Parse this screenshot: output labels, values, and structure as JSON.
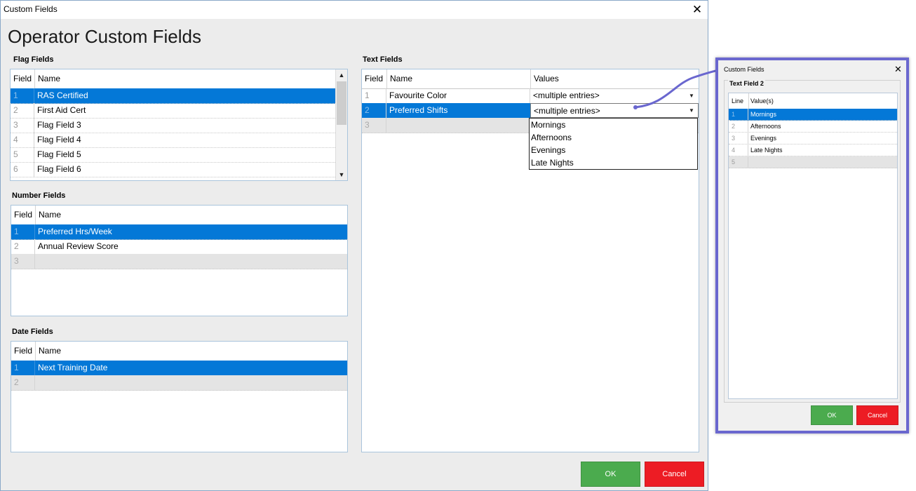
{
  "window": {
    "title": "Custom Fields",
    "heading": "Operator Custom Fields"
  },
  "flag_fields": {
    "label": "Flag Fields",
    "columns": [
      "Field",
      "Name"
    ],
    "rows": [
      {
        "num": "1",
        "name": "RAS Certified"
      },
      {
        "num": "2",
        "name": "First Aid Cert"
      },
      {
        "num": "3",
        "name": "Flag Field 3"
      },
      {
        "num": "4",
        "name": "Flag Field 4"
      },
      {
        "num": "5",
        "name": "Flag Field 5"
      },
      {
        "num": "6",
        "name": "Flag Field 6"
      }
    ]
  },
  "number_fields": {
    "label": "Number Fields",
    "columns": [
      "Field",
      "Name"
    ],
    "rows": [
      {
        "num": "1",
        "name": "Preferred Hrs/Week"
      },
      {
        "num": "2",
        "name": "Annual Review Score"
      },
      {
        "num": "3",
        "name": ""
      }
    ]
  },
  "date_fields": {
    "label": "Date Fields",
    "columns": [
      "Field",
      "Name"
    ],
    "rows": [
      {
        "num": "1",
        "name": "Next Training Date"
      },
      {
        "num": "2",
        "name": ""
      }
    ]
  },
  "text_fields": {
    "label": "Text Fields",
    "columns": [
      "Field",
      "Name",
      "Values"
    ],
    "rows": [
      {
        "num": "1",
        "name": "Favourite Color",
        "value": "<multiple entries>"
      },
      {
        "num": "2",
        "name": "Preferred Shifts",
        "value": "<multiple entries>"
      },
      {
        "num": "3",
        "name": "",
        "value": ""
      }
    ],
    "dropdown_options": [
      "Mornings",
      "Afternoons",
      "Evenings",
      "Late Nights"
    ]
  },
  "buttons": {
    "ok": "OK",
    "cancel": "Cancel"
  },
  "popup": {
    "title": "Custom Fields",
    "group_label": "Text Field 2",
    "columns": [
      "Line",
      "Value(s)"
    ],
    "rows": [
      {
        "num": "1",
        "value": "Mornings"
      },
      {
        "num": "2",
        "value": "Afternoons"
      },
      {
        "num": "3",
        "value": "Evenings"
      },
      {
        "num": "4",
        "value": "Late Nights"
      },
      {
        "num": "5",
        "value": ""
      }
    ],
    "ok": "OK",
    "cancel": "Cancel"
  },
  "colors": {
    "selection": "#0478d7",
    "ok_button": "#4bab4e",
    "cancel_button": "#ed1c24",
    "callout": "#6a67cf"
  },
  "icons": {
    "close": "close-icon",
    "scroll_up": "arrow-up-icon",
    "scroll_down": "arrow-down-icon",
    "dropdown": "chevron-down-icon"
  }
}
